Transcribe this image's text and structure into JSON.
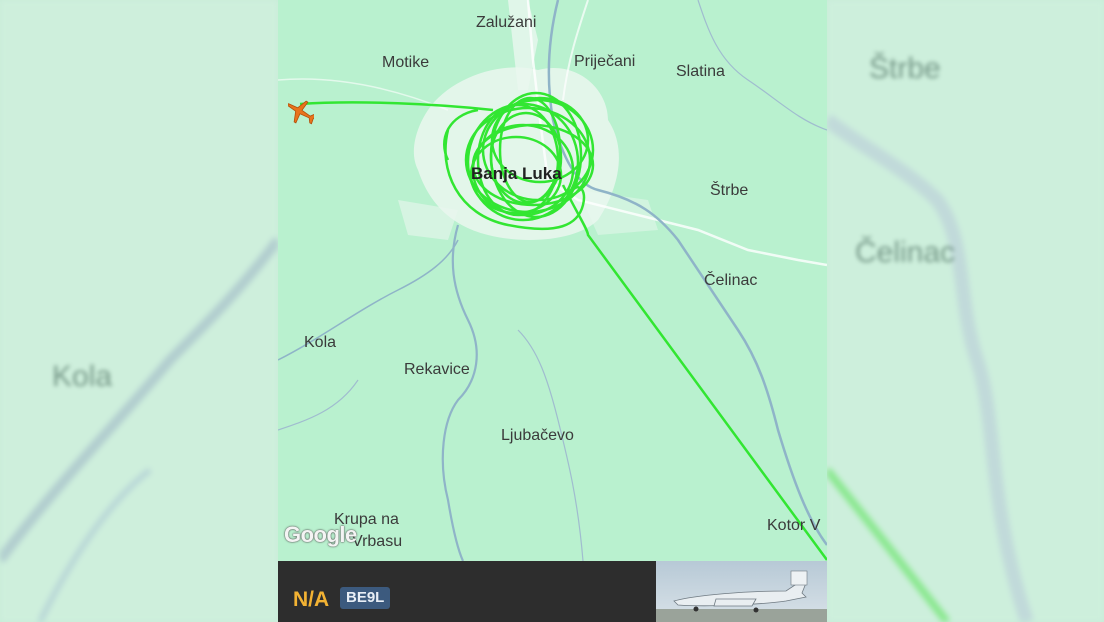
{
  "map": {
    "places": {
      "zaluzani": "Zalužani",
      "motike": "Motike",
      "prijecani": "Priječani",
      "slatina": "Slatina",
      "banja_luka": "Banja Luka",
      "strbe": "Štrbe",
      "celinac": "Čelinac",
      "kola": "Kola",
      "rekavice": "Rekavice",
      "ljubacevo": "Ljubačevo",
      "krupa_line1": "Krupa na",
      "krupa_line2": "Vrbasu",
      "kotor": "Kotor V"
    },
    "attribution": "Google",
    "track_color": "#32e632",
    "aircraft_icon": "orange-plane-icon"
  },
  "side_blur": {
    "left_label": "Kola",
    "right_label_1": "Štrbe",
    "right_label_2": "Čelinac"
  },
  "flight": {
    "callsign": "N/A",
    "aircraft_type": "BE9L",
    "callsign_color": "#f2b233"
  },
  "photo": {
    "subject": "aircraft-photo-thumbnail"
  }
}
